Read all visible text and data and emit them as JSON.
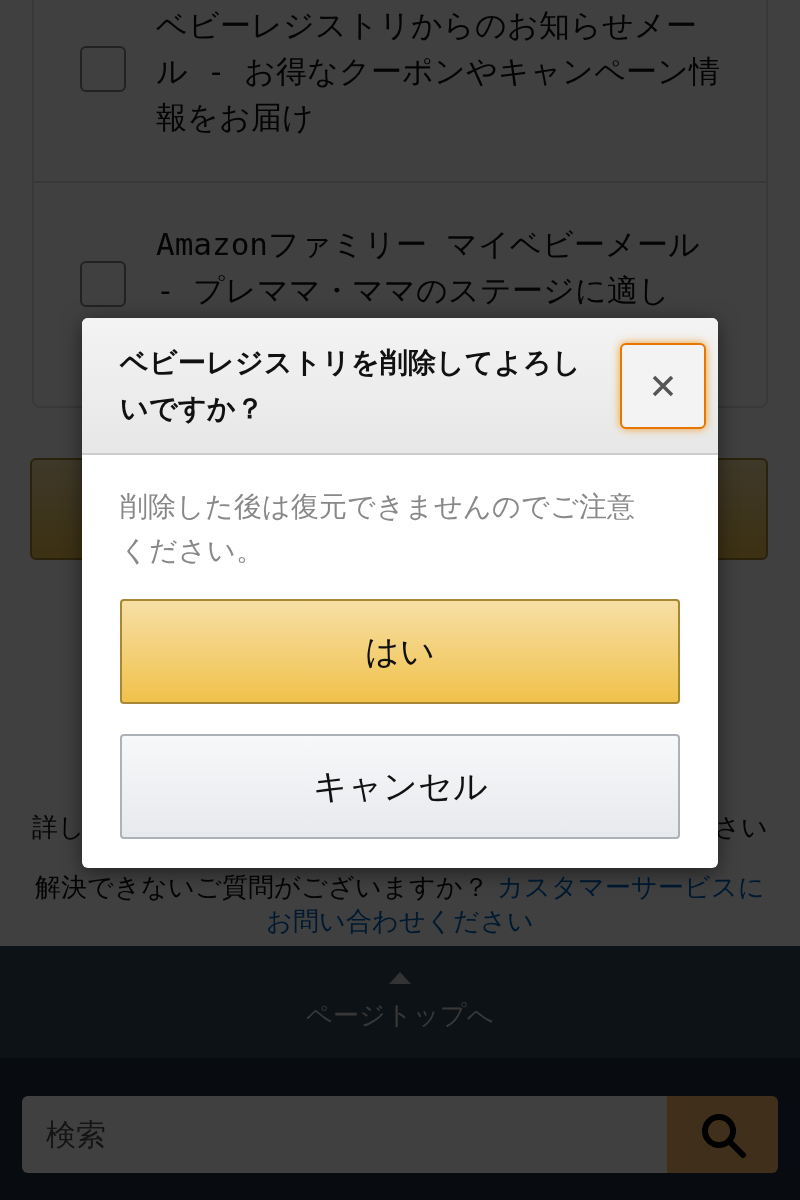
{
  "options": [
    {
      "label": "ベビーレジストリからのお知らせメール - お得なクーポンやキャンペーン情報をお届け",
      "checked": false
    },
    {
      "label": "Amazonファミリー マイベビーメール - プレママ・ママのステージに適し",
      "checked": false
    }
  ],
  "help": {
    "fragments": [
      "詳し",
      "さい"
    ],
    "question": "解決できないご質問がございますか？",
    "link_lines": [
      "カスタマーサービスに",
      "お問い合わせください"
    ]
  },
  "footer": {
    "back_to_top": "ページトップへ"
  },
  "search": {
    "placeholder": "検索"
  },
  "dialog": {
    "title": "ベビーレジストリを削除してよろしいですか？",
    "message": "削除した後は復元できませんのでご注意ください。",
    "buttons": [
      {
        "label": "はい",
        "kind": "primary"
      },
      {
        "label": "キャンセル",
        "kind": "secondary"
      }
    ]
  }
}
